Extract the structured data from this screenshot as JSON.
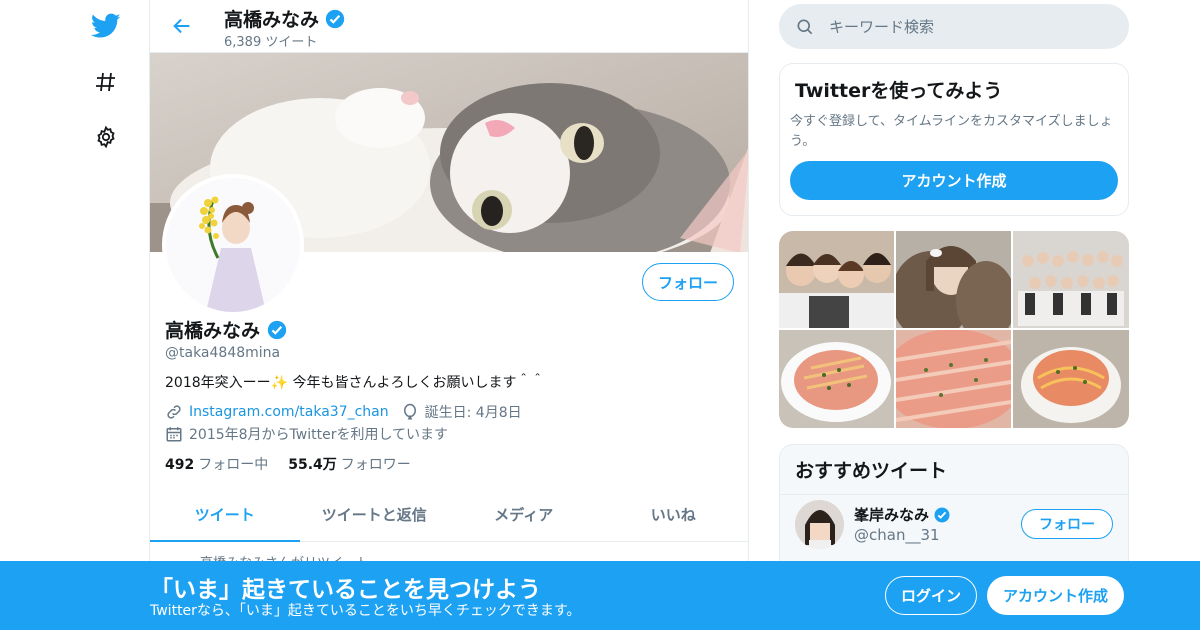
{
  "nav": {
    "logo_icon": "twitter-bird-icon",
    "explore_icon": "hashtag-icon",
    "settings_icon": "gear-icon"
  },
  "topbar": {
    "name": "高橋みなみ",
    "tweet_count": "6,389 ツイート"
  },
  "profile": {
    "name": "高橋みなみ",
    "handle": "@taka4848mina",
    "bio": "2018年突入ーー✨ 今年も皆さんよろしくお願いします＾＾",
    "link": "Instagram.com/taka37_chan",
    "birthday": "誕生日: 4月8日",
    "joined": "2015年8月からTwitterを利用しています",
    "following_count": "492",
    "following_label": "フォロー中",
    "followers_count": "55.4万",
    "followers_label": "フォロワー",
    "follow_button": "フォロー"
  },
  "tabs": [
    "ツイート",
    "ツイートと返信",
    "メディア",
    "いいね"
  ],
  "retweet_line": "高橋みなみさんがリツイート",
  "search": {
    "placeholder": "キーワード検索"
  },
  "signup_card": {
    "title": "Twitterを使ってみよう",
    "desc": "今すぐ登録して、タイムラインをカスタマイズしましょう。",
    "button": "アカウント作成"
  },
  "recommended": {
    "title": "おすすめツイート",
    "user_name": "峯岸みなみ",
    "user_handle": "@chan__31",
    "follow_button": "フォロー"
  },
  "bottom_bar": {
    "title": "「いま」起きていることを見つけよう",
    "subtitle": "Twitterなら、「いま」起きていることをいち早くチェックできます。",
    "login": "ログイン",
    "signup": "アカウント作成"
  },
  "colors": {
    "accent": "#1da1f2",
    "border": "#e6ecf0",
    "muted": "#657786"
  }
}
